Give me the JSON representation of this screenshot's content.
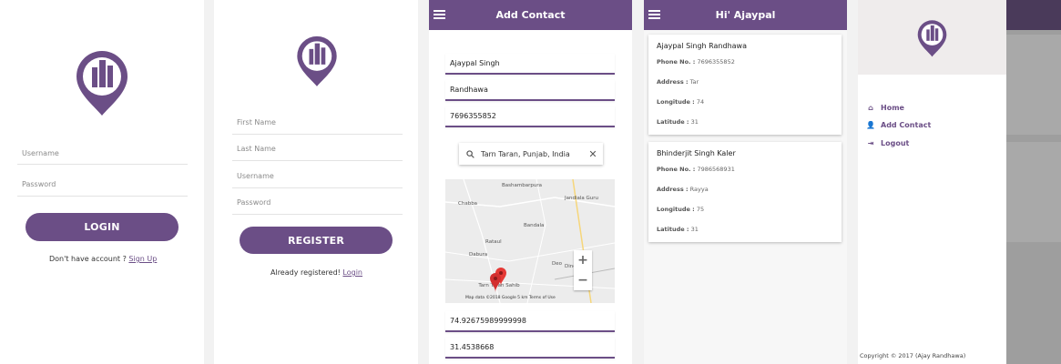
{
  "colors": {
    "primary": "#6b4e86",
    "accent": "#e53935"
  },
  "login": {
    "username_placeholder": "Username",
    "password_placeholder": "Password",
    "login_button": "LOGIN",
    "signup_prompt": "Don't have account ?",
    "signup_link": "Sign Up"
  },
  "register": {
    "first_name_placeholder": "First Name",
    "last_name_placeholder": "Last Name",
    "username_placeholder": "Username",
    "password_placeholder": "Password",
    "register_button": "REGISTER",
    "login_prompt": "Already registered!",
    "login_link": "Login"
  },
  "add_contact": {
    "title": "Add Contact",
    "first_name": "Ajaypal Singh",
    "last_name": "Randhawa",
    "phone": "7696355852",
    "search_value": "Tarn Taran, Punjab, India",
    "longitude": "74.92675989999998",
    "latitude": "31.4538668",
    "map": {
      "labels": [
        "Bashambarpura",
        "Jandiala Guru",
        "Chabba",
        "Bandala",
        "Rataul",
        "Dabura",
        "Deo",
        "Dinewal",
        "Tarn Taran Sahib"
      ],
      "footer": "Map data ©2018 Google   5 km   Terms of Use",
      "zoom_in": "+",
      "zoom_out": "−"
    }
  },
  "contacts": {
    "title": "Hi' Ajaypal",
    "phone_label": "Phone No. :",
    "address_label": "Address :",
    "longitude_label": "Longitude :",
    "latitude_label": "Latitude :",
    "items": [
      {
        "name": "Ajaypal Singh Randhawa",
        "phone": "7696355852",
        "address": "Tar",
        "longitude": "74",
        "latitude": "31"
      },
      {
        "name": "Bhinderjit Singh Kaler",
        "phone": "7986568931",
        "address": "Rayya",
        "longitude": "75",
        "latitude": "31"
      }
    ]
  },
  "drawer": {
    "items": [
      {
        "label": "Home",
        "icon": "home-icon"
      },
      {
        "label": "Add Contact",
        "icon": "add-person-icon"
      },
      {
        "label": "Logout",
        "icon": "logout-icon"
      }
    ],
    "copyright": "Copyright © 2017 (Ajay Randhawa)"
  }
}
